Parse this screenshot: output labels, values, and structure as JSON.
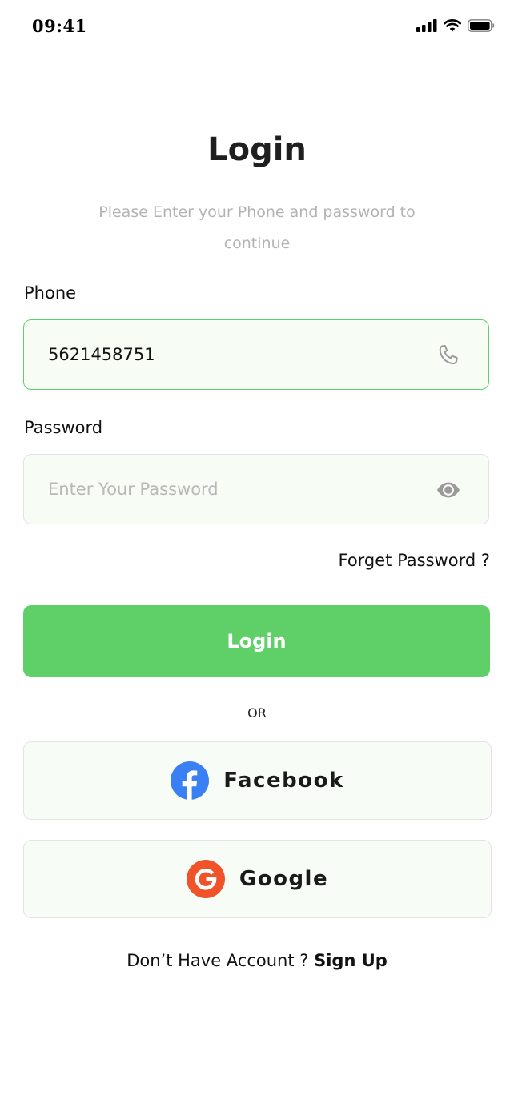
{
  "status_bar": {
    "time": "09:41"
  },
  "header": {
    "title": "Login",
    "subtitle": "Please Enter your Phone and password to continue"
  },
  "phone": {
    "label": "Phone",
    "value": "5621458751",
    "icon": "phone-icon"
  },
  "password": {
    "label": "Password",
    "placeholder": "Enter Your Password",
    "value": "",
    "icon": "eye-icon"
  },
  "forget_password": "Forget Password ?",
  "login_button": "Login",
  "divider": "OR",
  "social": {
    "facebook": {
      "label": "Facebook",
      "icon": "facebook-icon"
    },
    "google": {
      "label": "Google",
      "icon": "google-icon"
    }
  },
  "footer": {
    "prompt": "Don’t Have Account ? ",
    "signup": "Sign Up"
  },
  "colors": {
    "accent": "#5fd068",
    "field_bg": "#f7fcf5",
    "subtitle": "#b3b3b3",
    "facebook": "#3b7ff5",
    "google": "#f0522a"
  }
}
